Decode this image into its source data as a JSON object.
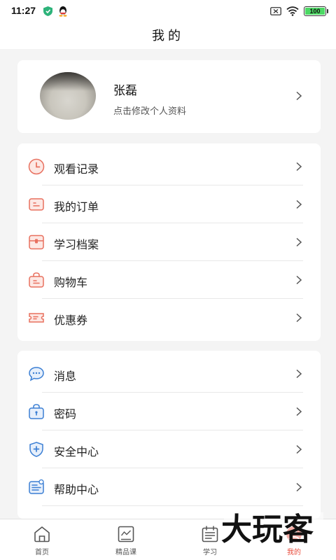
{
  "status_bar": {
    "time": "11:27",
    "battery": "100"
  },
  "nav": {
    "title": "我的"
  },
  "profile": {
    "name": "张磊",
    "subtitle": "点击修改个人资料"
  },
  "menu_group_1": [
    {
      "label": "观看记录",
      "icon": "clock-icon"
    },
    {
      "label": "我的订单",
      "icon": "order-icon"
    },
    {
      "label": "学习档案",
      "icon": "archive-icon"
    },
    {
      "label": "购物车",
      "icon": "shopping-bag-icon"
    },
    {
      "label": "优惠券",
      "icon": "coupon-icon"
    }
  ],
  "menu_group_2": [
    {
      "label": "消息",
      "icon": "message-icon"
    },
    {
      "label": "密码",
      "icon": "password-lock-icon"
    },
    {
      "label": "安全中心",
      "icon": "shield-icon"
    },
    {
      "label": "帮助中心",
      "icon": "help-icon"
    }
  ],
  "tabs": [
    {
      "label": "首页",
      "icon": "home-icon"
    },
    {
      "label": "精品课",
      "icon": "course-chart-icon"
    },
    {
      "label": "学习",
      "icon": "calendar-icon"
    },
    {
      "label": "我的",
      "icon": "profile-icon",
      "active": true
    }
  ],
  "watermark": {
    "text": "大玩客"
  },
  "colors": {
    "accent": "#e84d3d",
    "icon_red": "#e8705f",
    "icon_blue": "#3b7fd4",
    "background": "#f4f4f4"
  }
}
